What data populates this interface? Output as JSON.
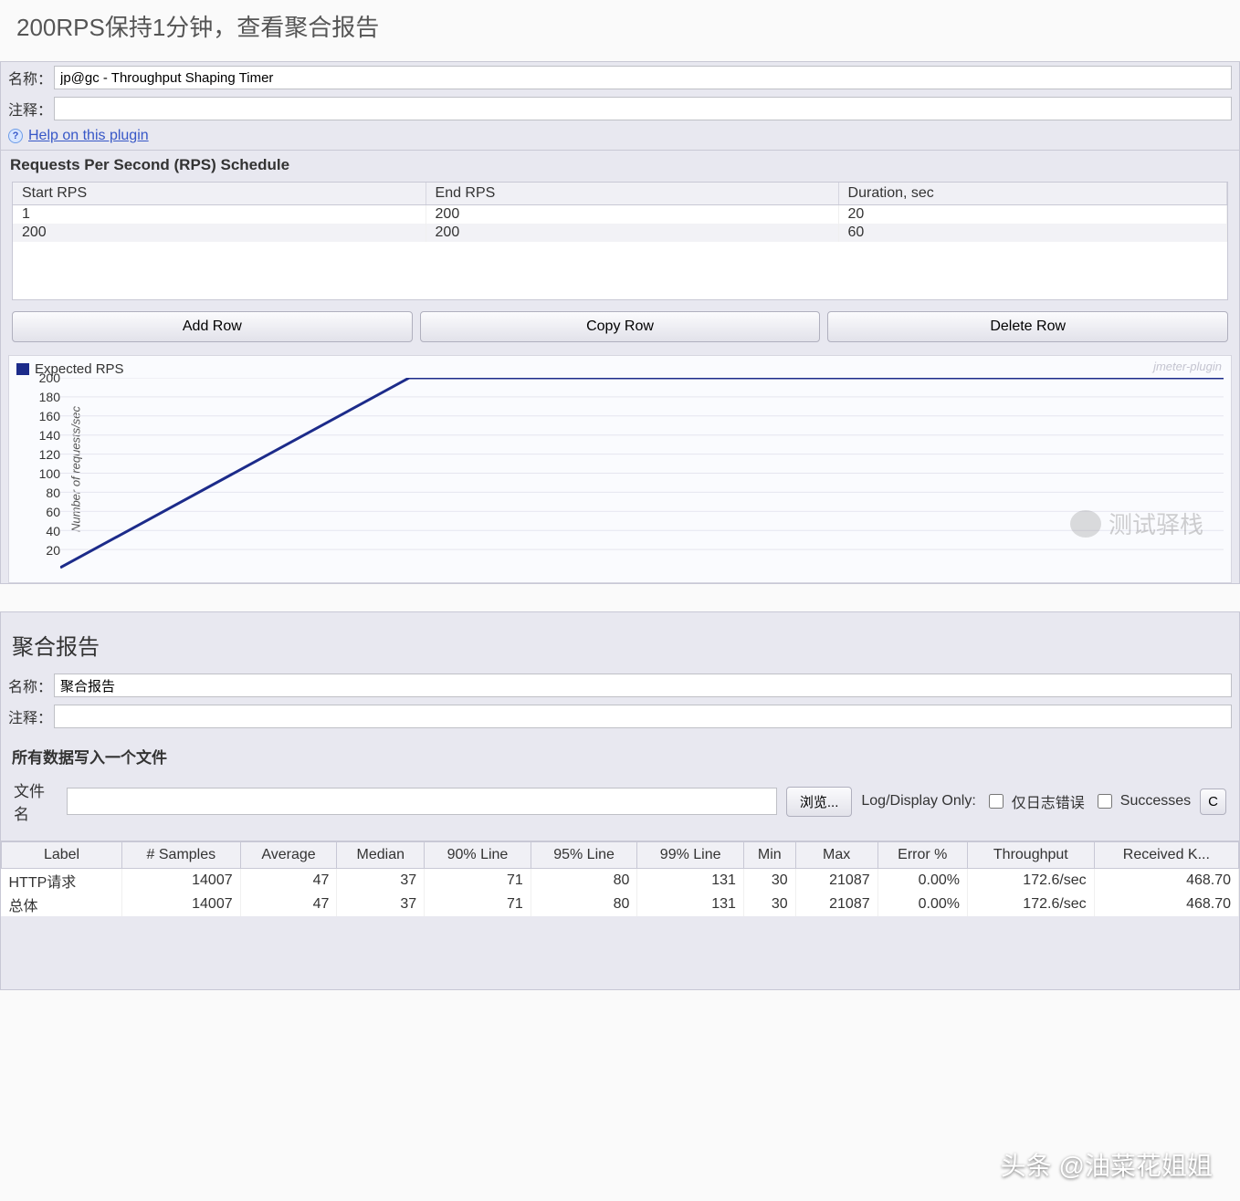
{
  "page_heading": "200RPS保持1分钟，查看聚合报告",
  "timer_panel": {
    "name_label": "名称：",
    "name_value": "jp@gc - Throughput Shaping Timer",
    "comment_label": "注释：",
    "comment_value": "",
    "help_link": "Help on this plugin",
    "section_title": "Requests Per Second (RPS) Schedule",
    "schedule_headers": [
      "Start RPS",
      "End RPS",
      "Duration, sec"
    ],
    "schedule_rows": [
      {
        "start": "1",
        "end": "200",
        "dur": "20"
      },
      {
        "start": "200",
        "end": "200",
        "dur": "60"
      }
    ],
    "buttons": {
      "add": "Add Row",
      "copy": "Copy Row",
      "delete": "Delete Row"
    },
    "legend": "Expected RPS",
    "watermark_plugin": "jmeter-plugin",
    "ylabel": "Number of requests/sec"
  },
  "chart_data": {
    "type": "line",
    "title": "",
    "xlabel": "",
    "ylabel": "Number of requests/sec",
    "ylim": [
      0,
      200
    ],
    "yticks": [
      20,
      40,
      60,
      80,
      100,
      120,
      140,
      160,
      180,
      200
    ],
    "series": [
      {
        "name": "Expected RPS",
        "color": "#1c2b8a",
        "x": [
          0,
          20,
          80
        ],
        "y": [
          1,
          200,
          200
        ]
      }
    ]
  },
  "watermark_wechat": "测试驿栈",
  "agg_panel": {
    "title": "聚合报告",
    "name_label": "名称：",
    "name_value": "聚合报告",
    "comment_label": "注释：",
    "comment_value": "",
    "alldata_title": "所有数据写入一个文件",
    "file_label": "文件名",
    "file_value": "",
    "browse_btn": "浏览...",
    "logdisplay_label": "Log/Display Only:",
    "chk1_label": "仅日志错误",
    "chk2_label": "Successes",
    "config_btn": "C",
    "headers": [
      "Label",
      "# Samples",
      "Average",
      "Median",
      "90% Line",
      "95% Line",
      "99% Line",
      "Min",
      "Max",
      "Error %",
      "Throughput",
      "Received K..."
    ],
    "rows": [
      {
        "label": "HTTP请求",
        "samples": "14007",
        "avg": "47",
        "median": "37",
        "p90": "71",
        "p95": "80",
        "p99": "131",
        "min": "30",
        "max": "21087",
        "err": "0.00%",
        "thr": "172.6/sec",
        "recv": "468.70"
      },
      {
        "label": "总体",
        "samples": "14007",
        "avg": "47",
        "median": "37",
        "p90": "71",
        "p95": "80",
        "p99": "131",
        "min": "30",
        "max": "21087",
        "err": "0.00%",
        "thr": "172.6/sec",
        "recv": "468.70"
      }
    ]
  },
  "footer_watermark": "头条 @油菜花姐姐"
}
